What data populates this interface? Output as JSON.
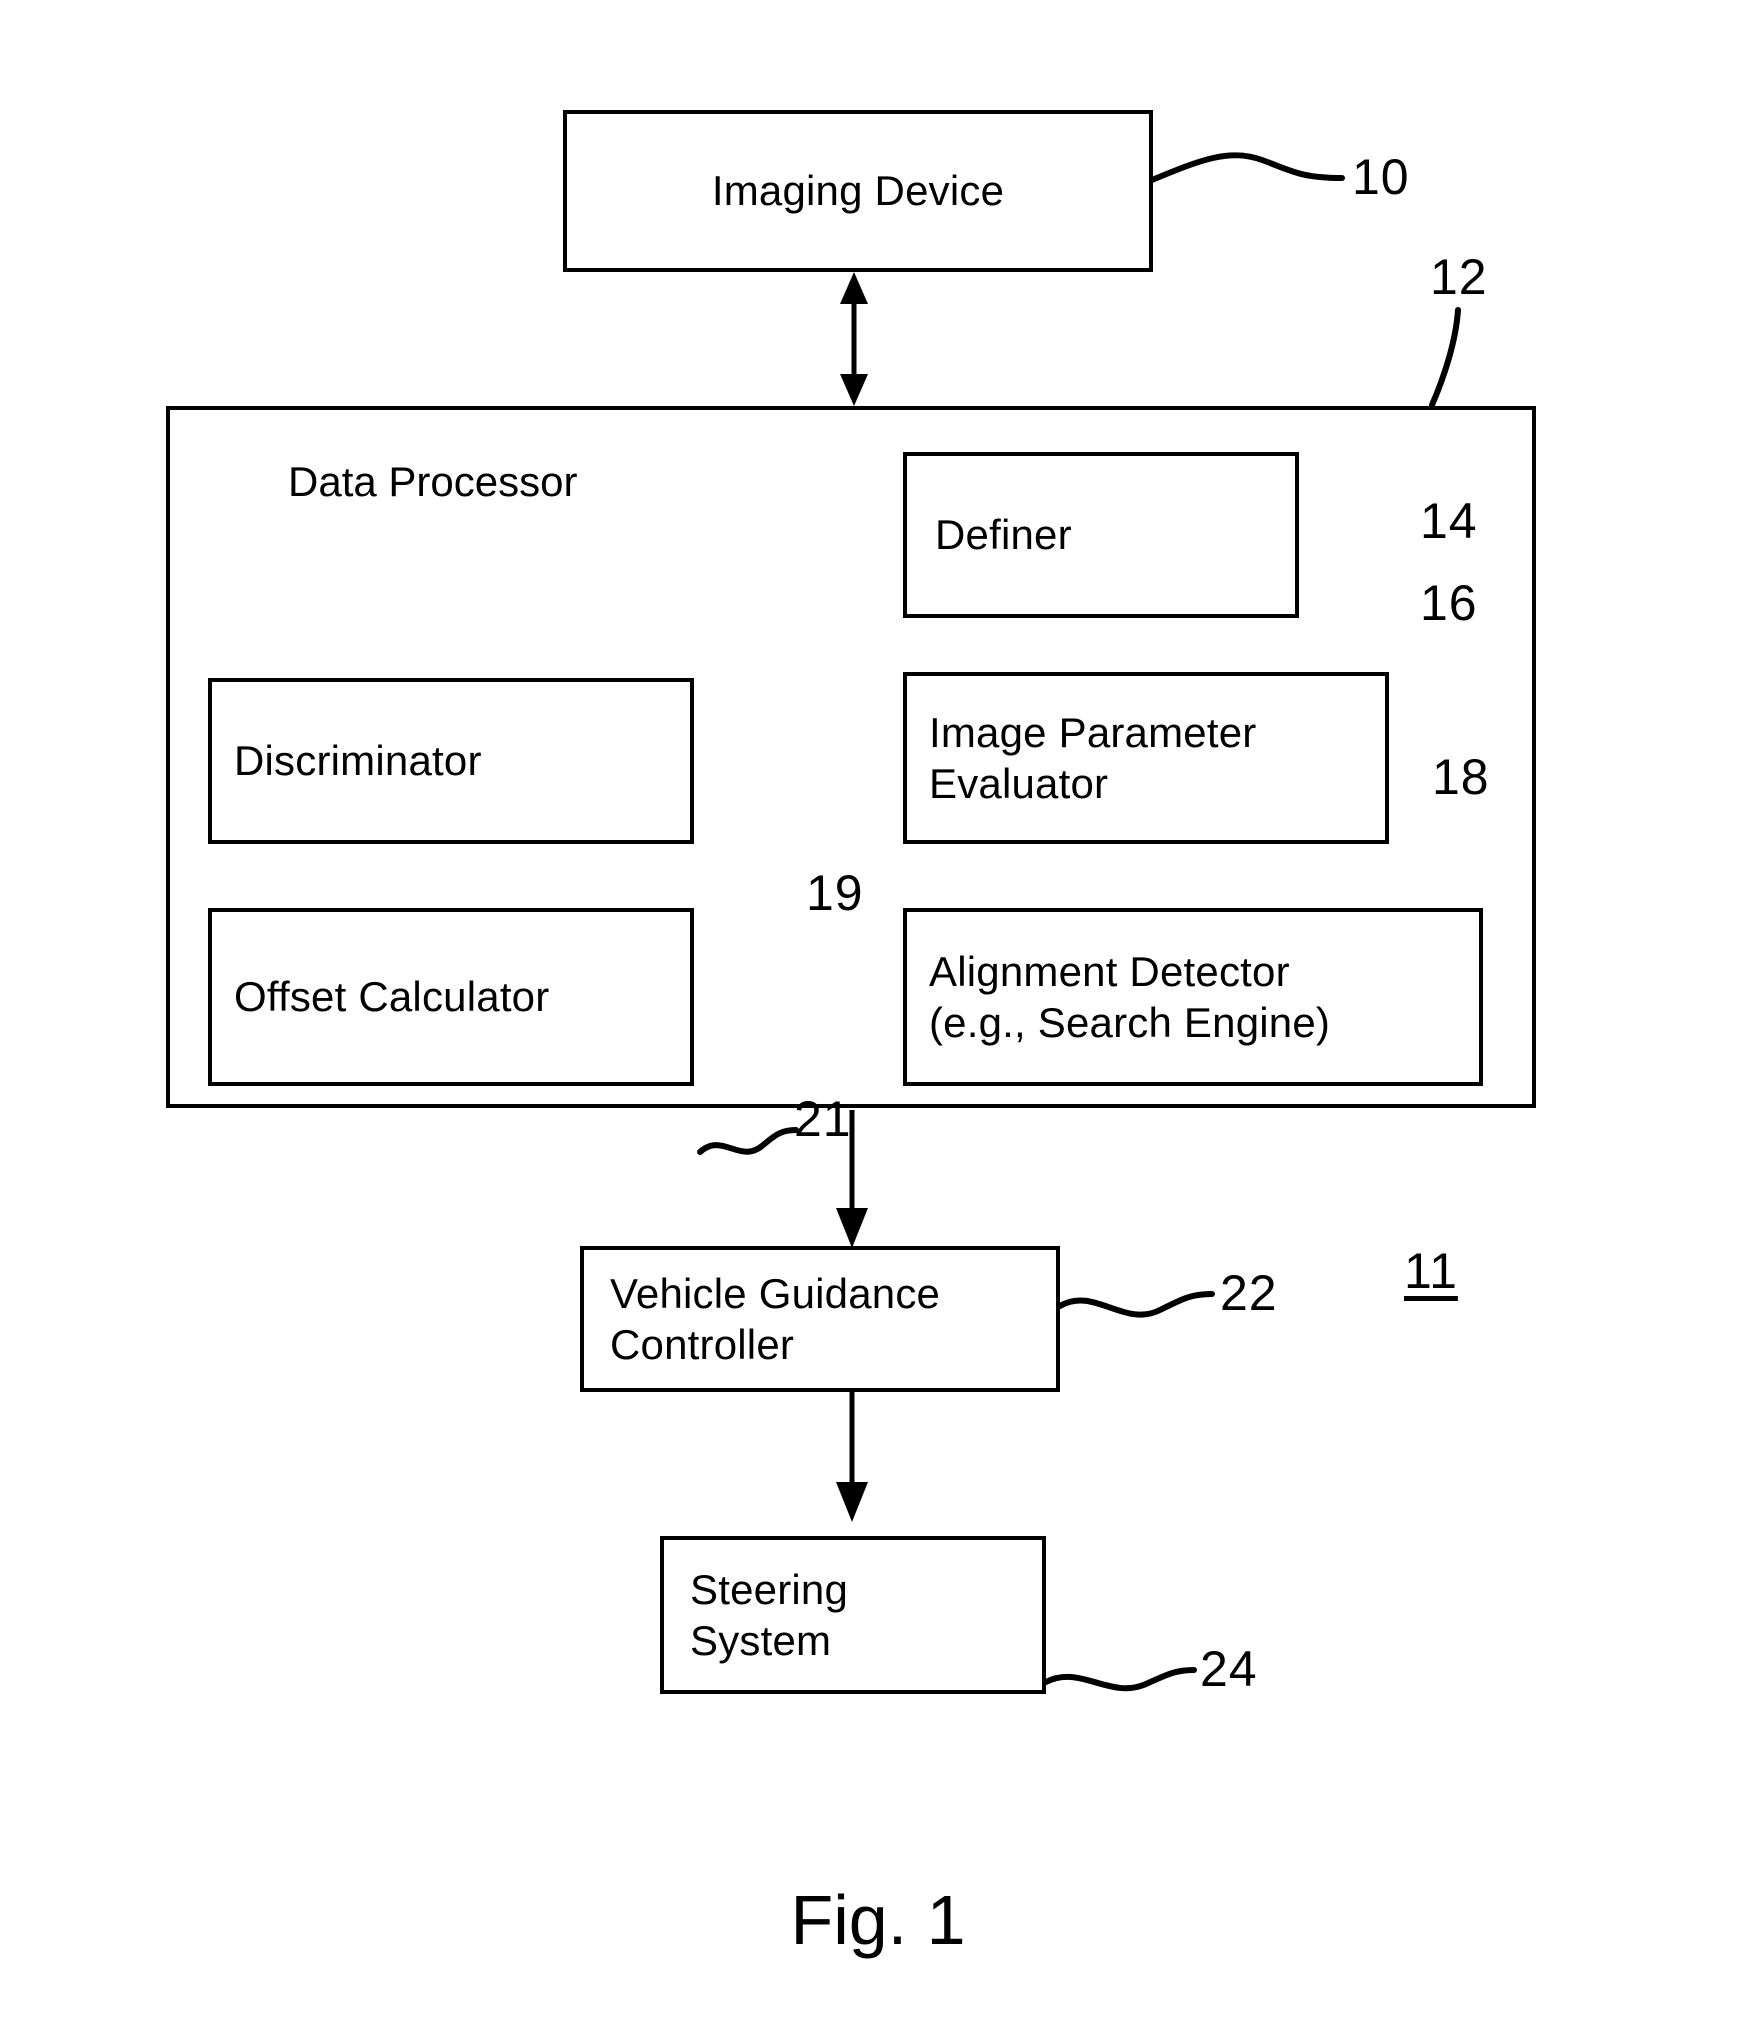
{
  "figure": {
    "caption": "Fig. 1",
    "system_ref": "11"
  },
  "blocks": {
    "imaging_device": {
      "label": "Imaging Device",
      "ref": "10"
    },
    "data_processor": {
      "label": "Data Processor",
      "ref": "12"
    },
    "definer": {
      "label": "Definer",
      "ref": "14"
    },
    "image_parameter_evaluator": {
      "label": "Image Parameter\nEvaluator",
      "ref": "16"
    },
    "alignment_detector": {
      "label": "Alignment Detector\n(e.g., Search Engine)",
      "ref": "18"
    },
    "discriminator": {
      "label": "Discriminator",
      "ref": "19"
    },
    "offset_calculator": {
      "label": "Offset Calculator",
      "ref": "21"
    },
    "vehicle_guidance_controller": {
      "label": "Vehicle Guidance\nController",
      "ref": "22"
    },
    "steering_system": {
      "label": "Steering\nSystem",
      "ref": "24"
    }
  },
  "connections": [
    {
      "from": "imaging_device",
      "to": "data_processor",
      "type": "double-arrow-vertical"
    },
    {
      "from": "data_processor",
      "to": "vehicle_guidance_controller",
      "type": "arrow-down"
    },
    {
      "from": "vehicle_guidance_controller",
      "to": "steering_system",
      "type": "arrow-down"
    }
  ],
  "colors": {
    "stroke": "#000000",
    "background": "#ffffff"
  }
}
